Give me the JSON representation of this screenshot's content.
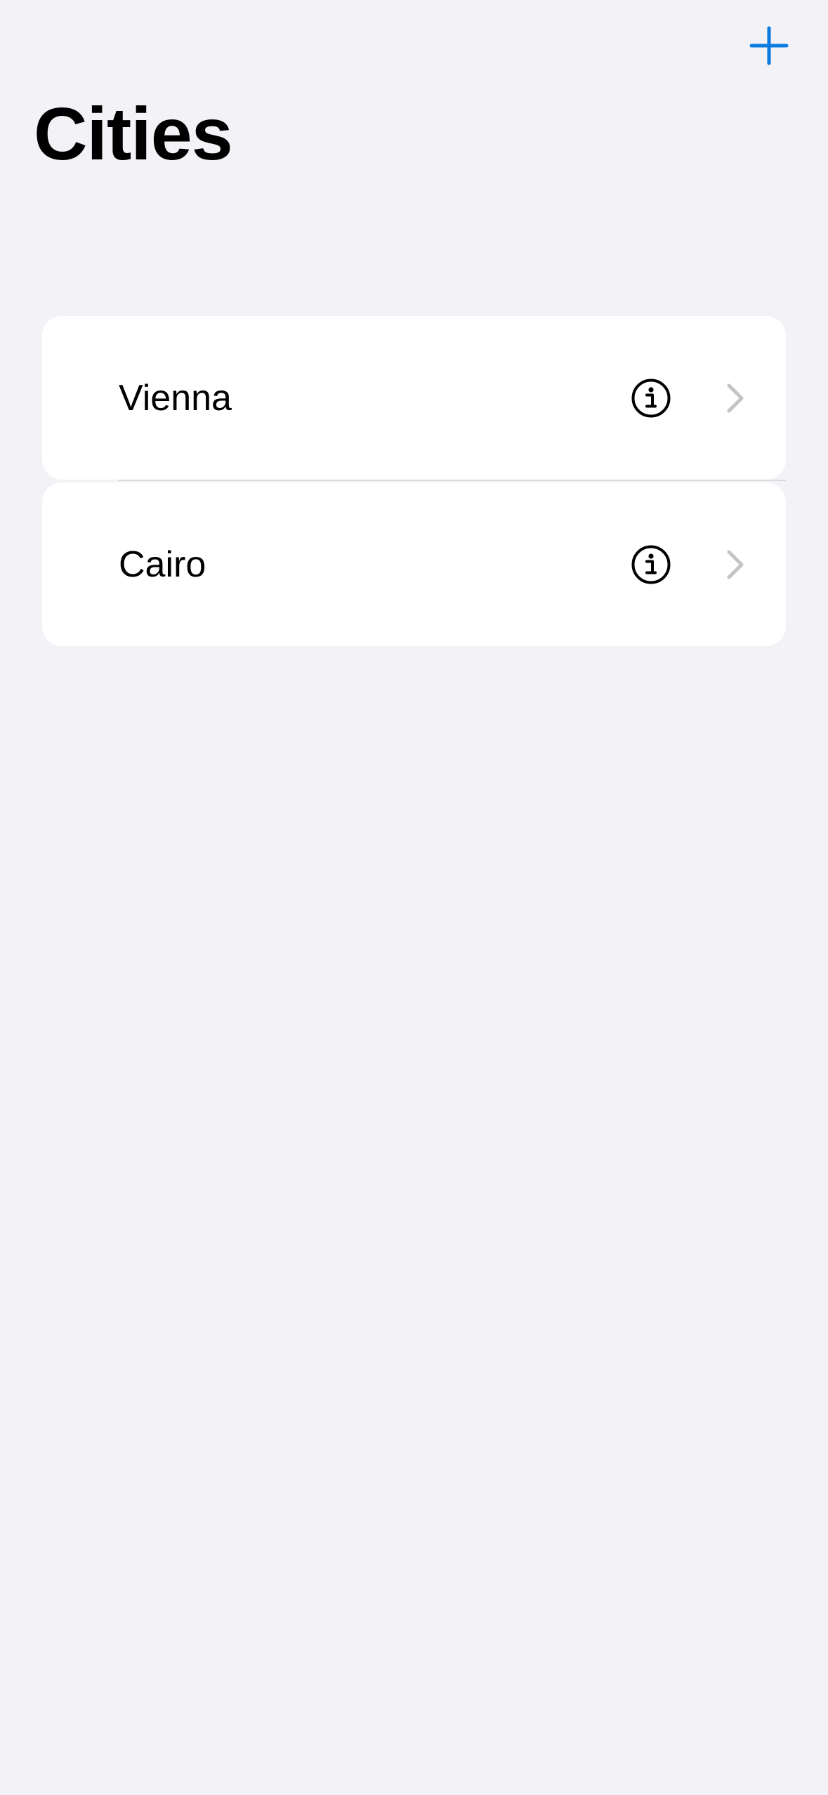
{
  "header": {
    "add_icon": "plus-icon",
    "title": "Cities"
  },
  "cities": {
    "items": [
      {
        "label": "Vienna",
        "info_icon": "info-circle-icon",
        "chevron_icon": "chevron-right-icon"
      },
      {
        "label": "Cairo",
        "info_icon": "info-circle-icon",
        "chevron_icon": "chevron-right-icon"
      }
    ]
  },
  "colors": {
    "background": "#f2f2f7",
    "card": "#ffffff",
    "accent": "#0a7bdf",
    "chevron": "#c4c4c7",
    "separator": "#d9d9de"
  }
}
